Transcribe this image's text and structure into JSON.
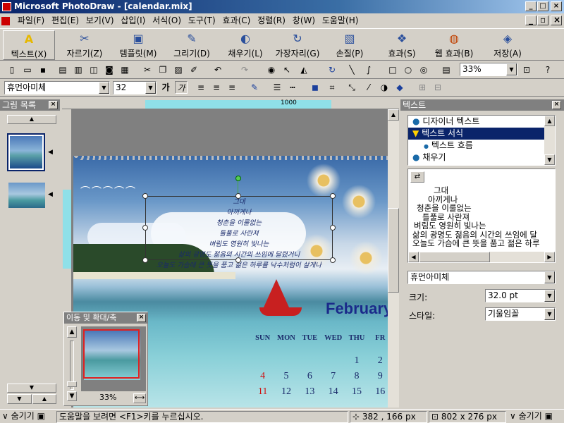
{
  "window": {
    "title": "Microsoft PhotoDraw - [calendar.mix]"
  },
  "menu": [
    "파일(F)",
    "편집(E)",
    "보기(V)",
    "삽입(I)",
    "서식(O)",
    "도구(T)",
    "효과(C)",
    "정렬(R)",
    "창(W)",
    "도움말(H)"
  ],
  "bigtoolbar": [
    "텍스트(X)",
    "자르기(Z)",
    "템플릿(M)",
    "그리기(D)",
    "채우기(L)",
    "가장자리(G)",
    "손질(P)",
    "효과(S)",
    "웹 효과(B)",
    "저장(A)"
  ],
  "toolbar": {
    "zoom": "33%"
  },
  "format": {
    "font": "휴먼아미체",
    "size": "32"
  },
  "ruler": {
    "mark": "1000"
  },
  "picture_list": {
    "title": "그림 목록"
  },
  "text_panel": {
    "title": "텍스트",
    "items": [
      "디자이너 텍스트",
      "텍스트 서식",
      "텍스트 흐름",
      "채우기"
    ],
    "preview_lines": [
      "그대",
      "아끼게나",
      "청춘을 이룰없는",
      "틀풀로 사란져",
      "벼림도 영원히 빛나는",
      "삶의 광명도 젊음의 시간의 쓰임에 달",
      "오늘도 가슴에 큰 뜻을 품고 젊은 하루"
    ],
    "font": "휴먼아미체",
    "size_label": "크기:",
    "size_value": "32.0 pt",
    "style_label": "스타일:",
    "style_value": "기울임꼴"
  },
  "canvas": {
    "poem": [
      "그대",
      "아끼게나",
      "청춘을 이룰없는",
      "틀풀로 사란져",
      "벼림도 영원히 빛나는",
      "삶의 광명도 젊음의 시간의 쓰임에 달렸거니",
      "오늘도 가슴에 큰 뜻을 품고 젊은 하루를 낙수처럼이 살게나"
    ],
    "month": "February",
    "days_header": [
      "SUN",
      "MON",
      "TUE",
      "WED",
      "THU",
      "FR"
    ],
    "row1": [
      "",
      "",
      "",
      "",
      "1",
      "2"
    ],
    "row2": [
      "4",
      "5",
      "6",
      "7",
      "8",
      "9"
    ],
    "row3": [
      "11",
      "12",
      "13",
      "14",
      "15",
      "16"
    ]
  },
  "navigator": {
    "title": "이동 및 확대/축",
    "zoom": "33%"
  },
  "status": {
    "hide_left": "숨기기",
    "help": "도움말을 보려면 <F1>키를 누르십시오.",
    "pos": "382 , 166  px",
    "size": "802 x 276  px",
    "hide_right": "숨기기"
  }
}
